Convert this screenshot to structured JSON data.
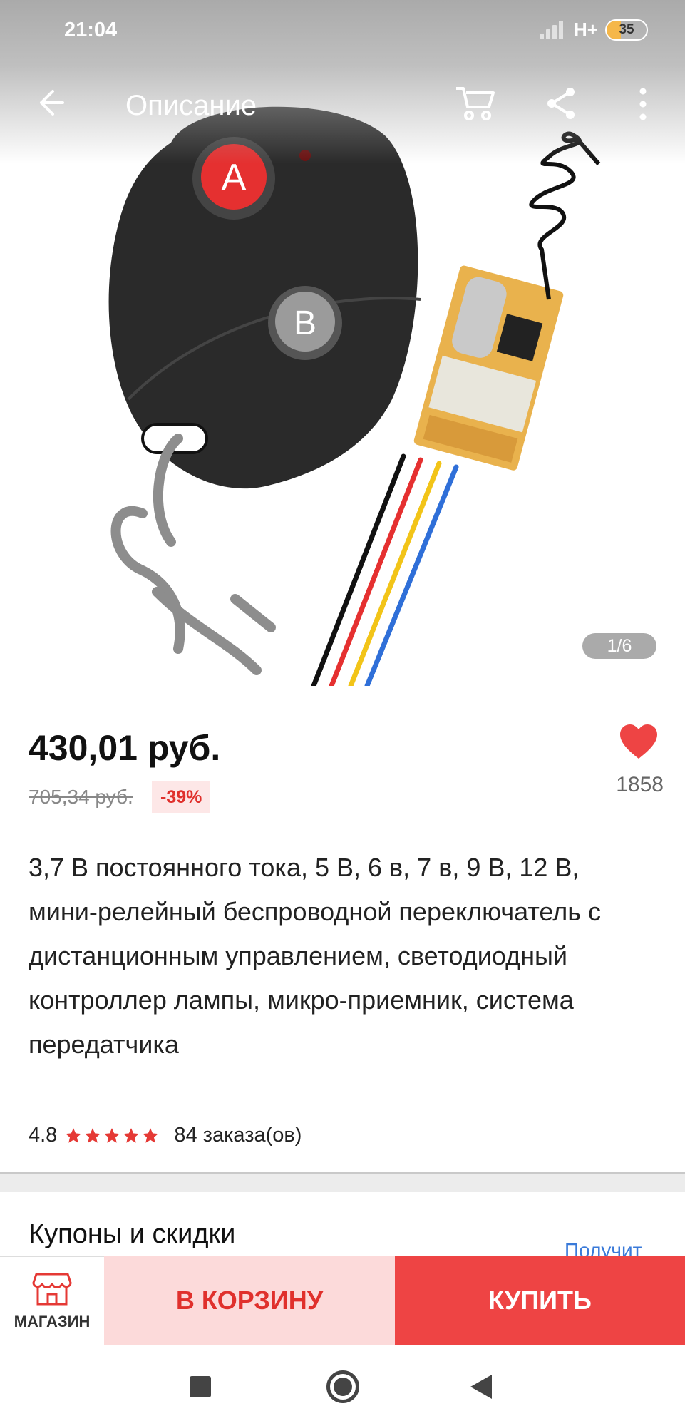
{
  "status_bar": {
    "time": "21:04",
    "network": "H+",
    "battery": "35",
    "battery_level": 0.35
  },
  "app_bar": {
    "title": "Описание"
  },
  "gallery": {
    "counter": "1/6",
    "current": 1,
    "total": 6,
    "remote_button_a": "A",
    "remote_button_b": "B"
  },
  "price": {
    "current": "430,01 руб.",
    "old": "705,34 руб.",
    "discount": "-39%"
  },
  "wishlist": {
    "count": "1858"
  },
  "product": {
    "title": "3,7 В постоянного тока, 5 В, 6 в, 7 в, 9 В, 12 В, мини-релейный беспроводной переключатель с дистанционным управлением, светодиодный контроллер лампы, микро-приемник, система передатчика",
    "rating": "4.8",
    "rating_value": 4.8,
    "orders": "84 заказа(ов)"
  },
  "coupons": {
    "title": "Купоны и скидки",
    "link": "Получит"
  },
  "actions": {
    "shop": "МАГАЗИН",
    "add_to_cart": "В КОРЗИНУ",
    "buy": "КУПИТЬ"
  },
  "colors": {
    "accent": "#ee4444",
    "cart_bg": "#fcdada",
    "star": "#e53935",
    "link": "#3a7ad9"
  }
}
